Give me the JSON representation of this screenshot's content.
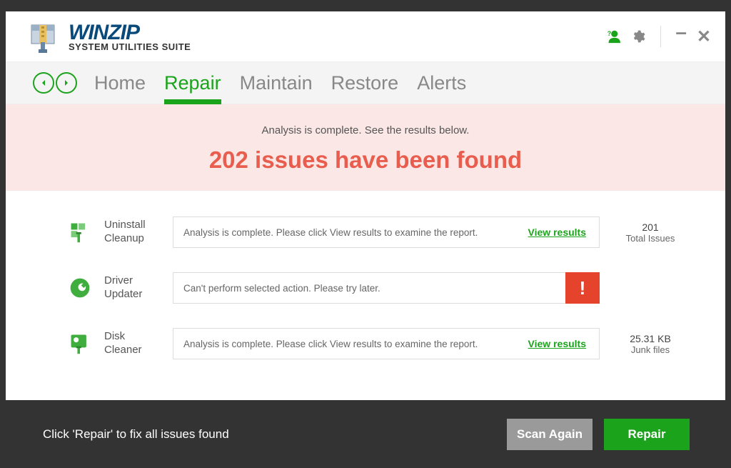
{
  "app": {
    "name_main": "WINZIP",
    "name_sub": "SYSTEM UTILITIES SUITE"
  },
  "nav": {
    "tabs": [
      "Home",
      "Repair",
      "Maintain",
      "Restore",
      "Alerts"
    ],
    "active_index": 1
  },
  "banner": {
    "sub": "Analysis is complete. See the results below.",
    "main": "202 issues have been found"
  },
  "rows": [
    {
      "icon": "cleanup-icon",
      "label": "Uninstall Cleanup",
      "message": "Analysis is complete. Please click View results to examine the report.",
      "link": "View results",
      "has_alert": false,
      "stat_value": "201",
      "stat_label": "Total Issues"
    },
    {
      "icon": "driver-icon",
      "label": "Driver Updater",
      "message": "Can't perform selected action. Please try later.",
      "link": "",
      "has_alert": true,
      "stat_value": "",
      "stat_label": ""
    },
    {
      "icon": "disk-icon",
      "label": "Disk Cleaner",
      "message": "Analysis is complete. Please click View results to examine the report.",
      "link": "View results",
      "has_alert": false,
      "stat_value": "25.31 KB",
      "stat_label": "Junk files"
    }
  ],
  "footer": {
    "text": "Click 'Repair' to fix all issues found",
    "scan_again": "Scan Again",
    "repair": "Repair"
  }
}
